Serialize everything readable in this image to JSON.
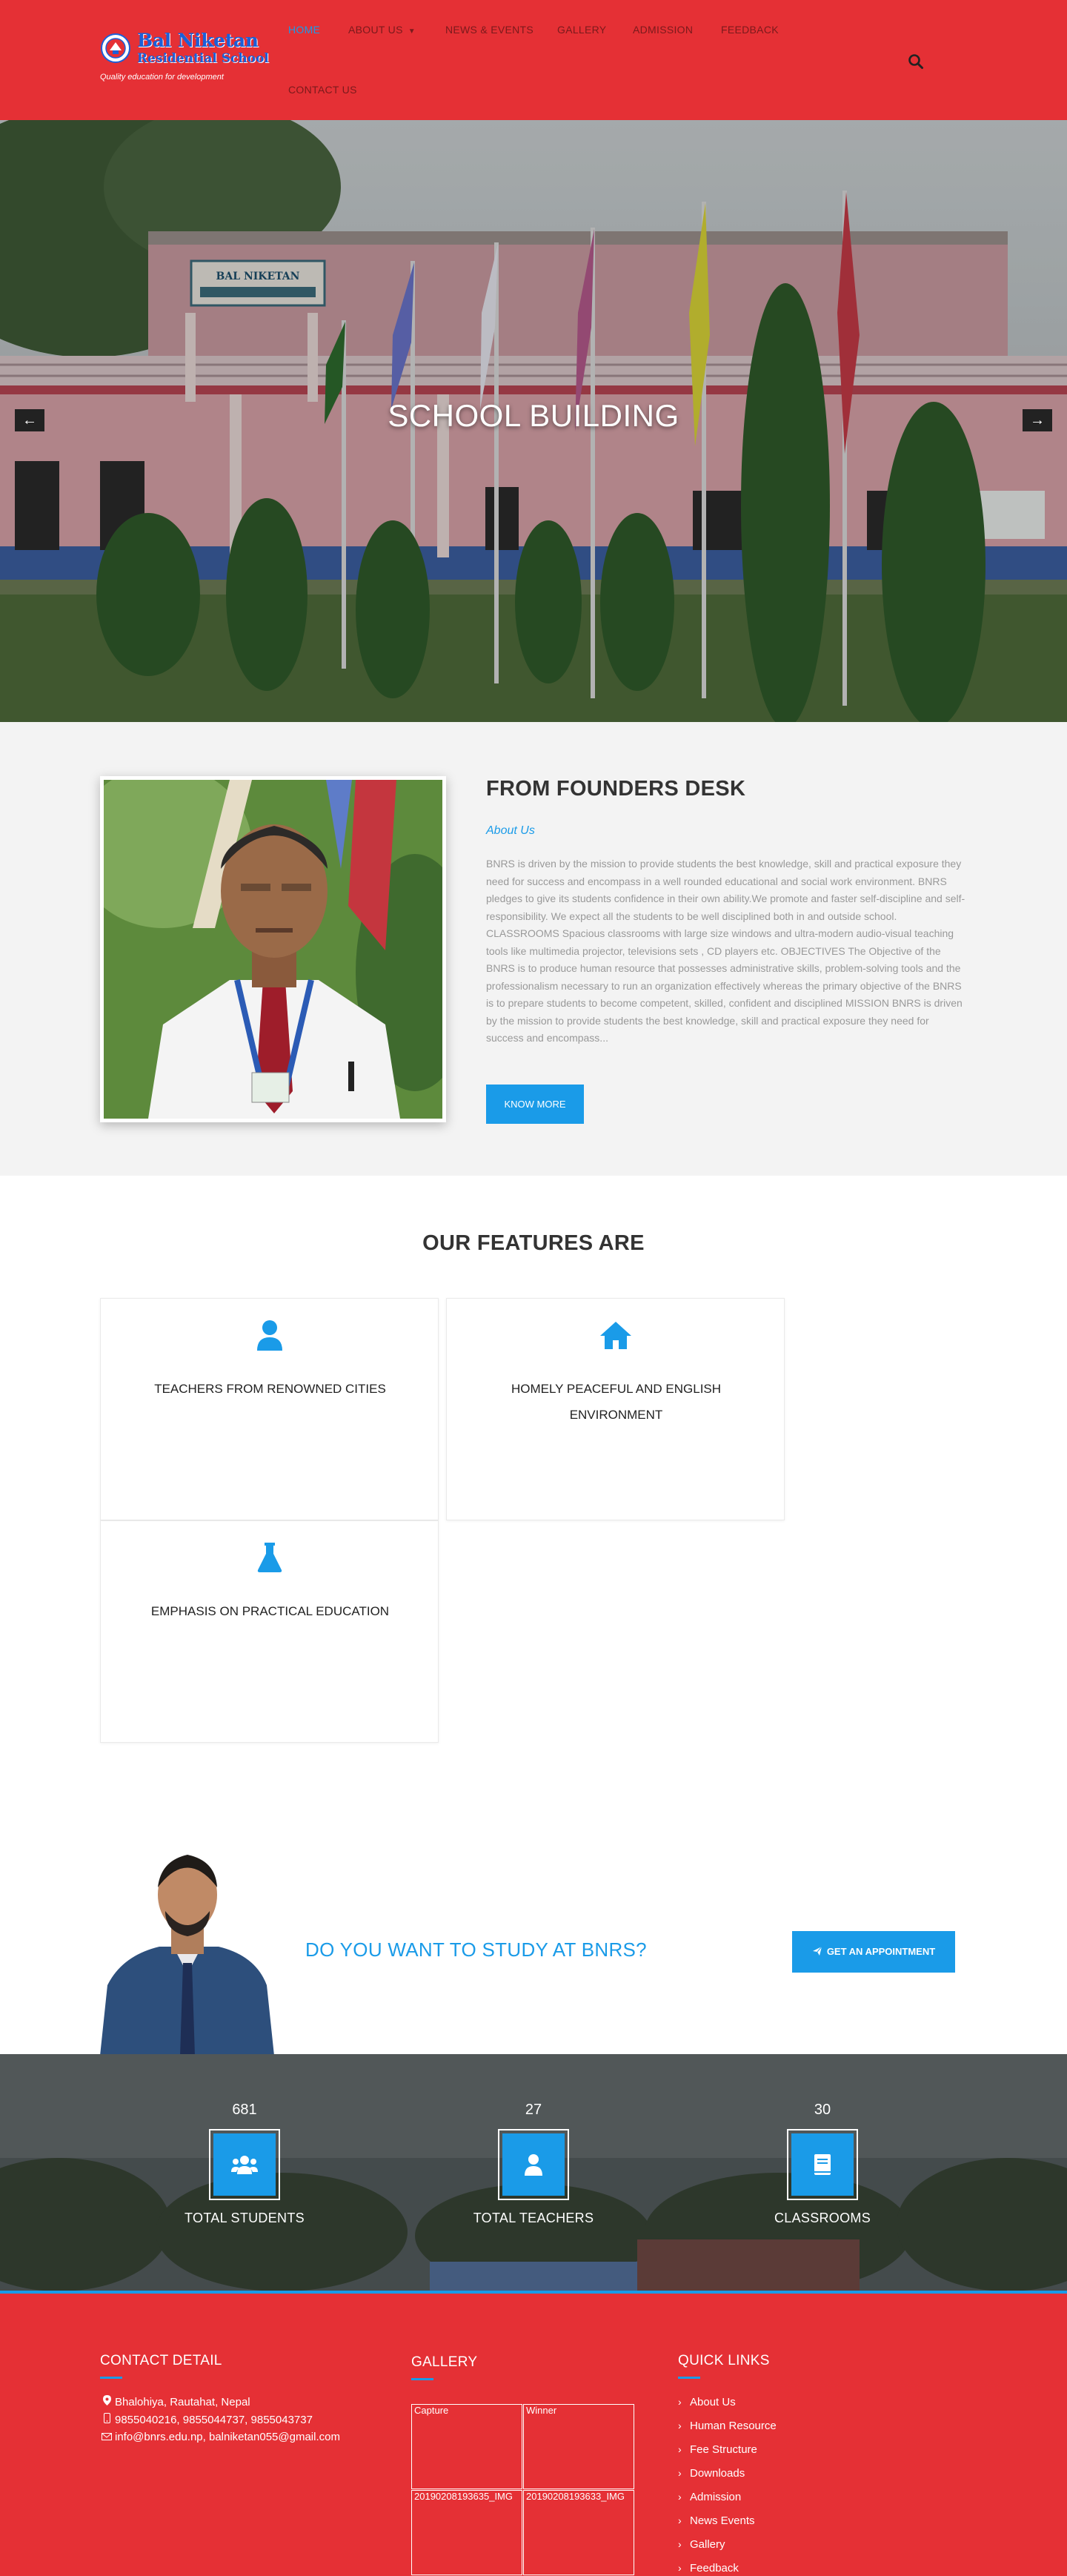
{
  "brand": {
    "name_line1": "Bal Niketan",
    "name_line2": "Residential School",
    "tagline": "Quality education for development"
  },
  "nav": {
    "items": [
      {
        "label": "HOME",
        "active": true
      },
      {
        "label": "ABOUT US",
        "has_dropdown": true
      },
      {
        "label": "NEWS & EVENTS"
      },
      {
        "label": "GALLERY"
      },
      {
        "label": "ADMISSION"
      },
      {
        "label": "FEEDBACK"
      },
      {
        "label": "CONTACT US"
      }
    ],
    "search_icon": "search-icon"
  },
  "hero": {
    "title": "SCHOOL BUILDING",
    "prev_arrow": "←",
    "next_arrow": "→",
    "building_sign": "BAL NIKETAN"
  },
  "founder": {
    "title": "FROM FOUNDERS DESK",
    "subtitle": "About Us",
    "text": "BNRS is driven by the mission to provide students the best knowledge, skill and practical exposure they need for success and encompass in a well rounded educational and social work environment. BNRS pledges to give its students confidence in their own ability.We promote and faster self-discipline and self-responsibility. We expect all the students to be well disciplined both in and outside school. CLASSROOMS Spacious classrooms with large size windows and ultra-modern audio-visual teaching tools like multimedia projector, televisions sets , CD players etc. OBJECTIVES The Objective of the BNRS is to produce human resource that possesses administrative skills, problem-solving tools and the professionalism necessary to run an organization effectively whereas the primary objective of the BNRS is to prepare students to become competent, skilled, confident and disciplined MISSION BNRS is driven by the mission to provide students the best knowledge, skill and practical exposure they need for success and encompass...",
    "button": "KNOW MORE"
  },
  "features": {
    "title": "OUR FEATURES ARE",
    "items": [
      {
        "label": "TEACHERS FROM RENOWNED CITIES",
        "icon": "user-icon"
      },
      {
        "label": "HOMELY PEACEFUL AND ENGLISH ENVIRONMENT",
        "icon": "home-icon"
      },
      {
        "label": "EMPHASIS ON PRACTICAL EDUCATION",
        "icon": "flask-icon"
      }
    ]
  },
  "cta": {
    "text": "DO YOU WANT TO STUDY AT BNRS?",
    "button": "GET AN APPOINTMENT",
    "button_icon": "paper-plane-icon"
  },
  "stats": [
    {
      "value": "681",
      "label": "TOTAL STUDENTS",
      "icon": "users-icon"
    },
    {
      "value": "27",
      "label": "TOTAL TEACHERS",
      "icon": "user-icon"
    },
    {
      "value": "30",
      "label": "CLASSROOMS",
      "icon": "book-icon"
    }
  ],
  "footer": {
    "contact": {
      "title": "CONTACT DETAIL",
      "address": "Bhalohiya, Rautahat, Nepal",
      "phone": "9855040216, 9855044737, 9855043737",
      "email": "info@bnrs.edu.np, balniketan055@gmail.com"
    },
    "gallery": {
      "title": "GALLERY",
      "items": [
        "Capture",
        "Winner",
        "20190208193635_IMG",
        "20190208193633_IMG"
      ]
    },
    "quick_links": {
      "title": "QUICK LINKS",
      "items": [
        "About Us",
        "Human Resource",
        "Fee Structure",
        "Downloads",
        "Admission",
        "News Events",
        "Gallery",
        "Feedback"
      ]
    }
  },
  "colors": {
    "primary_red": "#e53035",
    "accent_blue": "#1a9be8",
    "nav_text": "#7a1a1c"
  }
}
